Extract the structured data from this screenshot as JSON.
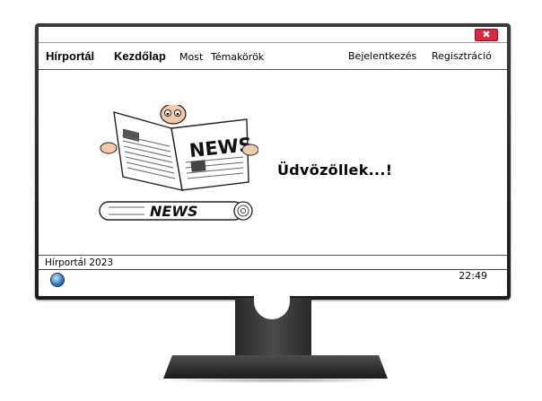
{
  "window": {
    "close_glyph": "✖"
  },
  "nav": {
    "brand": "Hírportál",
    "home": "Kezdőlap",
    "now": "Most",
    "topics": "Témakörök",
    "login": "Bejelentkezés",
    "register": "Regisztráció"
  },
  "main": {
    "illustration_newspaper_text": "NEWS",
    "illustration_roll_text": "NEWS",
    "welcome": "Üdvözöllek...!"
  },
  "footer": {
    "text": "Hírportál 2023"
  },
  "taskbar": {
    "start_icon": "windows-start-orb",
    "clock": "22:49"
  },
  "colors": {
    "close_button": "#e0263a",
    "bezel": "#222222",
    "screen_bg": "#ffffff"
  }
}
